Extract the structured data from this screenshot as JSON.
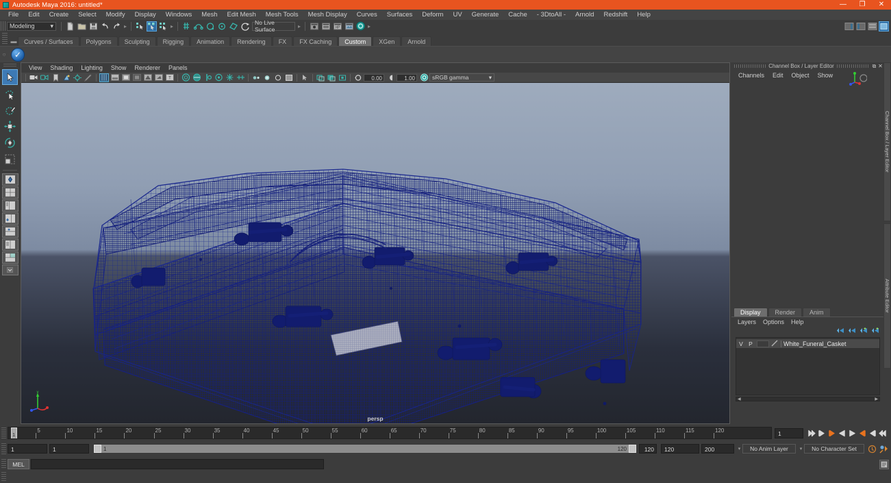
{
  "window": {
    "title": "Autodesk Maya 2016: untitled*",
    "app_icon": "maya-icon",
    "controls": {
      "minimize": "—",
      "maximize": "❐",
      "close": "✕"
    },
    "accent_color": "#e8541f"
  },
  "menubar": {
    "items": [
      "File",
      "Edit",
      "Create",
      "Select",
      "Modify",
      "Display",
      "Windows",
      "Mesh",
      "Edit Mesh",
      "Mesh Tools",
      "Mesh Display",
      "Curves",
      "Surfaces",
      "Deform",
      "UV",
      "Generate",
      "Cache",
      "- 3DtoAll -",
      "Arnold",
      "Redshift",
      "Help"
    ]
  },
  "statusline": {
    "mode": "Modeling",
    "live_surface": "No Live Surface",
    "dropdown_caret": "▾"
  },
  "shelf": {
    "tabs": [
      "Curves / Surfaces",
      "Polygons",
      "Sculpting",
      "Rigging",
      "Animation",
      "Rendering",
      "FX",
      "FX Caching",
      "Custom",
      "XGen",
      "Arnold"
    ],
    "active_tab": "Custom"
  },
  "viewport": {
    "menu": [
      "View",
      "Shading",
      "Lighting",
      "Show",
      "Renderer",
      "Panels"
    ],
    "exposure_value": "0.00",
    "gamma_value": "1.00",
    "color_space": "sRGB gamma",
    "camera_label": "persp",
    "axes": {
      "x": "x",
      "y": "y",
      "z": "z"
    },
    "background_top": "#9aa8ba",
    "background_bottom": "#23262f",
    "wireframe_color": "#1b2a8c"
  },
  "channel_box": {
    "panel_title": "Channel Box / Layer Editor",
    "menu": [
      "Channels",
      "Edit",
      "Object",
      "Show"
    ],
    "float_icon": "⧉",
    "close_icon": "✕"
  },
  "layer_editor": {
    "tabs": [
      "Display",
      "Render",
      "Anim"
    ],
    "active_tab": "Display",
    "menu": [
      "Layers",
      "Options",
      "Help"
    ],
    "layers": [
      {
        "visibility": "V",
        "playback": "P",
        "name": "White_Funeral_Casket",
        "color": "#b4b4b4"
      }
    ]
  },
  "side_tabs": [
    "Channel Box / Layer Editor",
    "Attribute Editor"
  ],
  "time_slider": {
    "start": 1,
    "end": 120,
    "current_frame": "1",
    "tick_labels": [
      5,
      10,
      15,
      20,
      25,
      30,
      35,
      40,
      45,
      50,
      55,
      60,
      65,
      70,
      75,
      80,
      85,
      90,
      95,
      100,
      105,
      110,
      115,
      120
    ],
    "playback_buttons": [
      "❘◀◀",
      "❘◀",
      "◀❘",
      "◀",
      "▶",
      "❘▶",
      "▶❘",
      "▶▶❘"
    ]
  },
  "range_slider": {
    "anim_start": "1",
    "range_start": "1",
    "bar_start_label": "1",
    "bar_end_label": "120",
    "range_end": "120",
    "anim_end": "200",
    "playback_end_field": "120",
    "anim_layer": "No Anim Layer",
    "character_set": "No Character Set"
  },
  "command_line": {
    "language": "MEL",
    "input_value": "",
    "output_value": ""
  },
  "help_line": {
    "text": ""
  }
}
